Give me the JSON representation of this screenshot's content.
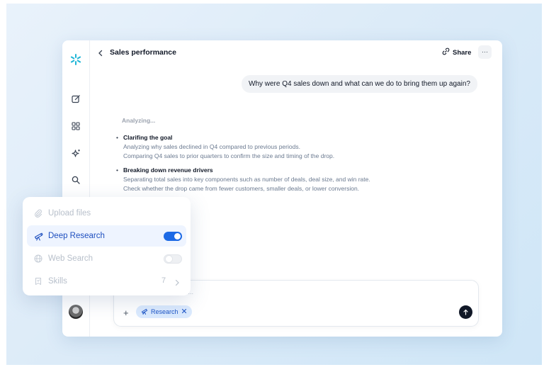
{
  "header": {
    "title": "Sales performance",
    "share_label": "Share",
    "more_label": "···"
  },
  "conversation": {
    "user_message": "Why were Q4 sales down and what can we do to bring them up again?",
    "status": "Analyzing...",
    "steps": [
      {
        "title": "Clarifing the goal",
        "lines": [
          "Analyzing why sales declined in Q4 compared to previous periods.",
          "Comparing Q4 sales to prior quarters to confirm the size and timing of the drop."
        ]
      },
      {
        "title": "Breaking down revenue drivers",
        "lines": [
          "Separating total sales into key components such as number of deals, deal size, and win rate.",
          "Check whether the drop came from fewer customers, smaller deals, or lower conversion."
        ]
      }
    ]
  },
  "composer": {
    "placeholder_visible": "ce...",
    "plus_label": "+",
    "chip_label": "Research"
  },
  "tools_menu": {
    "items": [
      {
        "label": "Upload files",
        "icon": "paperclip-icon",
        "enabled": false
      },
      {
        "label": "Deep Research",
        "icon": "telescope-icon",
        "toggle": true,
        "on": true
      },
      {
        "label": "Web Search",
        "icon": "globe-icon",
        "toggle": true,
        "on": false
      },
      {
        "label": "Skills",
        "icon": "skills-icon",
        "count": "7"
      }
    ]
  },
  "sidebar": {
    "icons": [
      "logo-icon",
      "new-chat-icon",
      "grid-icon",
      "sparkle-icon",
      "search-icon",
      "avatar"
    ]
  },
  "colors": {
    "accent": "#1d6ae5",
    "logo": "#1fb5d6",
    "chip_bg": "#dbeafe",
    "send_bg": "#111827"
  }
}
